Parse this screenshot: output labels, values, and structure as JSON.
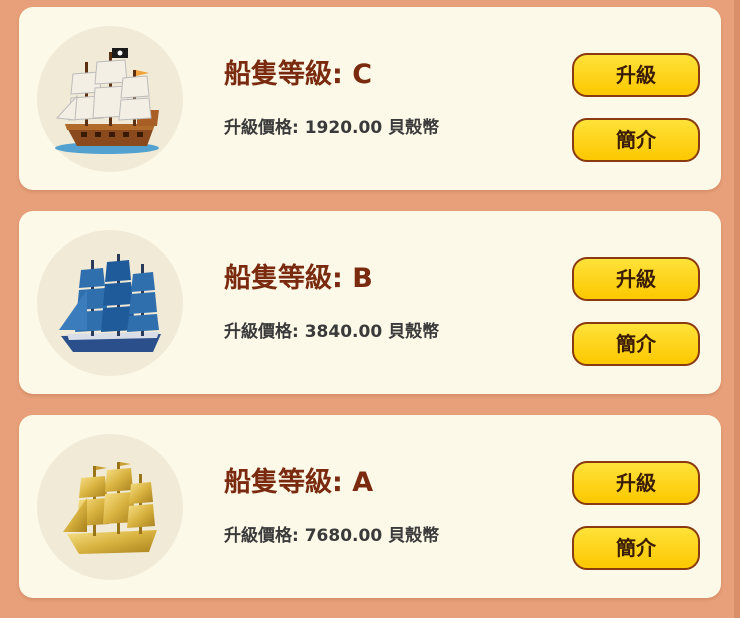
{
  "ships": [
    {
      "grade_text": "船隻等級: C",
      "price_text": "升級價格: 1920.00 貝殼幣",
      "upgrade_label": "升級",
      "info_label": "簡介",
      "ship_icon": "pirate-galleon-icon"
    },
    {
      "grade_text": "船隻等級: B",
      "price_text": "升級價格: 3840.00 貝殼幣",
      "upgrade_label": "升級",
      "info_label": "簡介",
      "ship_icon": "blue-clipper-ship-icon"
    },
    {
      "grade_text": "船隻等級: A",
      "price_text": "升級價格: 7680.00 貝殼幣",
      "upgrade_label": "升級",
      "info_label": "簡介",
      "ship_icon": "golden-ship-icon"
    }
  ],
  "colors": {
    "background": "#e8a07a",
    "card": "#fcf9e8",
    "grade_text": "#7a2a0e",
    "button_fill": "#fcd000",
    "button_border": "#8a3a10"
  }
}
